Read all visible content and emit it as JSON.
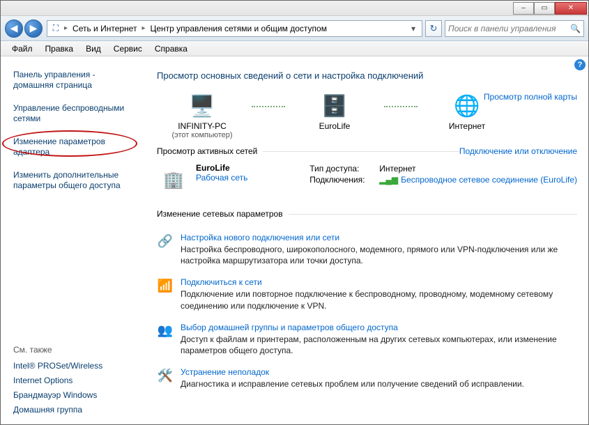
{
  "window_controls": {
    "min": "–",
    "max": "▭",
    "close": "✕"
  },
  "nav": {
    "back_glyph": "◀",
    "fwd_glyph": "▶",
    "refresh_glyph": "↻",
    "dropdown_glyph": "▾"
  },
  "breadcrumb": {
    "icon_glyph": "⛶",
    "segments": [
      "Сеть и Интернет",
      "Центр управления сетями и общим доступом"
    ]
  },
  "search": {
    "placeholder": "Поиск в панели управления",
    "icon_glyph": "🔍"
  },
  "menubar": [
    "Файл",
    "Правка",
    "Вид",
    "Сервис",
    "Справка"
  ],
  "sidebar": {
    "links": [
      "Панель управления - домашняя страница",
      "Управление беспроводными сетями",
      "Изменение параметров адаптера",
      "Изменить дополнительные параметры общего доступа"
    ],
    "see_also_hdr": "См. также",
    "see_also": [
      "Intel® PROSet/Wireless",
      "Internet Options",
      "Брандмауэр Windows",
      "Домашняя группа"
    ]
  },
  "main": {
    "help_glyph": "?",
    "header": "Просмотр основных сведений о сети и настройка подключений",
    "full_map_link": "Просмотр полной карты",
    "overview": {
      "pc": {
        "name": "INFINITY-PC",
        "sub": "(этот компьютер)",
        "glyph": "🖥️"
      },
      "net": {
        "name": "EuroLife",
        "glyph": "🗄️"
      },
      "web": {
        "name": "Интернет",
        "glyph": "🌐"
      }
    },
    "active_hdr": "Просмотр активных сетей",
    "conn_or_disc": "Подключение или отключение",
    "active": {
      "icon_glyph": "🏢",
      "name": "EuroLife",
      "type": "Рабочая сеть",
      "rows": [
        {
          "k": "Тип доступа:",
          "v": "Интернет"
        },
        {
          "k": "Подключения:",
          "v": "Беспроводное сетевое соединение (EuroLife)",
          "signal_glyph": "▂▄▆"
        }
      ]
    },
    "params_hdr": "Изменение сетевых параметров",
    "tasks": [
      {
        "glyph": "🔗",
        "title": "Настройка нового подключения или сети",
        "desc": "Настройка беспроводного, широкополосного, модемного, прямого или VPN-подключения или же настройка маршрутизатора или точки доступа."
      },
      {
        "glyph": "📶",
        "title": "Подключиться к сети",
        "desc": "Подключение или повторное подключение к беспроводному, проводному, модемному сетевому соединению или подключение к VPN."
      },
      {
        "glyph": "👥",
        "title": "Выбор домашней группы и параметров общего доступа",
        "desc": "Доступ к файлам и принтерам, расположенным на других сетевых компьютерах, или изменение параметров общего доступа."
      },
      {
        "glyph": "🛠️",
        "title": "Устранение неполадок",
        "desc": "Диагностика и исправление сетевых проблем или получение сведений об исправлении."
      }
    ]
  }
}
